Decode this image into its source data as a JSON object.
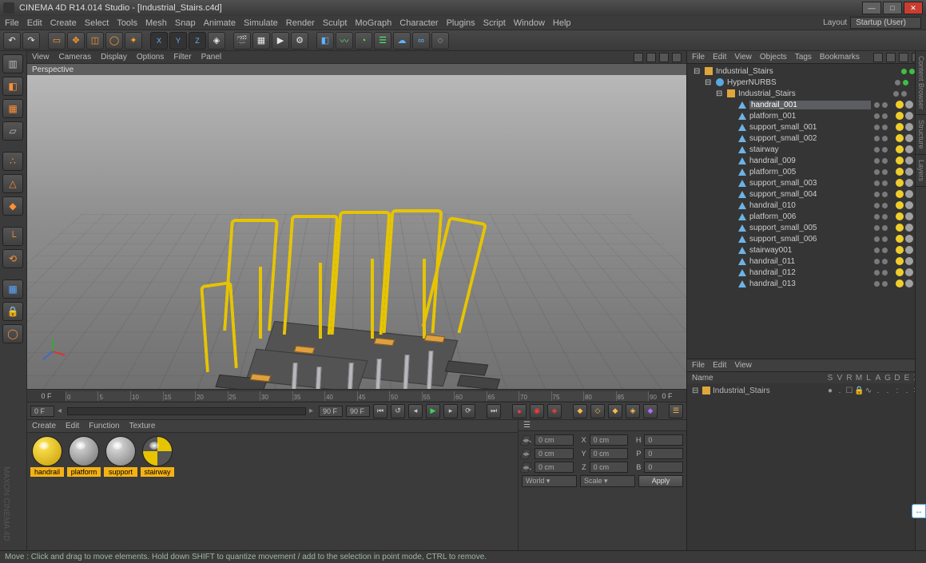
{
  "titlebar": {
    "text": "CINEMA 4D R14.014 Studio - [Industrial_Stairs.c4d]"
  },
  "menu": {
    "items": [
      "File",
      "Edit",
      "Create",
      "Select",
      "Tools",
      "Mesh",
      "Snap",
      "Animate",
      "Simulate",
      "Render",
      "Sculpt",
      "MoGraph",
      "Character",
      "Plugins",
      "Script",
      "Window",
      "Help"
    ],
    "layout_label": "Layout",
    "layout_value": "Startup (User)"
  },
  "viewport": {
    "menus": [
      "View",
      "Cameras",
      "Display",
      "Options",
      "Filter",
      "Panel"
    ],
    "label": "Perspective"
  },
  "timeline": {
    "start": "0 F",
    "end": "0 F",
    "ticks": [
      "0",
      "5",
      "10",
      "15",
      "20",
      "25",
      "30",
      "35",
      "40",
      "45",
      "50",
      "55",
      "60",
      "65",
      "70",
      "75",
      "80",
      "85",
      "90"
    ],
    "live_start": "0 F",
    "live_end": "90 F",
    "end2": "90 F"
  },
  "materials": {
    "menu": [
      "Create",
      "Edit",
      "Function",
      "Texture"
    ],
    "items": [
      {
        "name": "handrail",
        "bg": "radial-gradient(circle at 35% 30%, #ffe75a, #c79b00)"
      },
      {
        "name": "platform",
        "bg": "radial-gradient(circle at 35% 30%, #dcdcdc, #6e6e6e)"
      },
      {
        "name": "support",
        "bg": "radial-gradient(circle at 35% 30%, #e2e2e2, #7a7a7a)"
      },
      {
        "name": "stairway",
        "bg": "conic-gradient(#e6c400 0 90deg, #555 90deg 180deg, #e6c400 180deg 270deg, #555 270deg 360deg)"
      }
    ]
  },
  "coords": {
    "rows": [
      {
        "axis": "X",
        "p": "0 cm",
        "s": "0 cm",
        "a": "H",
        "v": "0"
      },
      {
        "axis": "Y",
        "p": "0 cm",
        "s": "0 cm",
        "a": "P",
        "v": "0"
      },
      {
        "axis": "Z",
        "p": "0 cm",
        "s": "0 cm",
        "a": "B",
        "v": "0"
      }
    ],
    "world": "World",
    "scale": "Scale",
    "apply": "Apply"
  },
  "objects": {
    "menu": [
      "File",
      "Edit",
      "View",
      "Objects",
      "Tags",
      "Bookmarks"
    ],
    "tree": [
      {
        "d": 0,
        "type": "cube",
        "name": "Industrial_Stairs",
        "exp": "⊟",
        "dots": [
          "green",
          "green"
        ],
        "tags": []
      },
      {
        "d": 1,
        "type": "null",
        "name": "HyperNURBS",
        "exp": "⊟",
        "dots": [
          "grey",
          "green"
        ],
        "tags": [
          "green-check"
        ]
      },
      {
        "d": 2,
        "type": "cube",
        "name": "Industrial_Stairs",
        "exp": "⊟",
        "dots": [
          "grey",
          "grey"
        ],
        "tags": [
          "checker"
        ]
      },
      {
        "d": 3,
        "type": "pyr",
        "name": "handrail_001",
        "sel": true,
        "dots": [
          "grey",
          "grey"
        ],
        "tags": [
          "yellow",
          "grey",
          "checker"
        ]
      },
      {
        "d": 3,
        "type": "pyr",
        "name": "platform_001",
        "dots": [
          "grey",
          "grey"
        ],
        "tags": [
          "yellow",
          "grey",
          "checker"
        ]
      },
      {
        "d": 3,
        "type": "pyr",
        "name": "support_small_001",
        "dots": [
          "grey",
          "grey"
        ],
        "tags": [
          "yellow",
          "grey",
          "checker"
        ]
      },
      {
        "d": 3,
        "type": "pyr",
        "name": "support_small_002",
        "dots": [
          "grey",
          "grey"
        ],
        "tags": [
          "yellow",
          "grey",
          "checker"
        ]
      },
      {
        "d": 3,
        "type": "pyr",
        "name": "stairway",
        "dots": [
          "grey",
          "grey"
        ],
        "tags": [
          "yellow",
          "grey",
          "checker"
        ]
      },
      {
        "d": 3,
        "type": "pyr",
        "name": "handrail_009",
        "dots": [
          "grey",
          "grey"
        ],
        "tags": [
          "yellow",
          "grey",
          "checker"
        ]
      },
      {
        "d": 3,
        "type": "pyr",
        "name": "platform_005",
        "dots": [
          "grey",
          "grey"
        ],
        "tags": [
          "yellow",
          "grey",
          "checker"
        ]
      },
      {
        "d": 3,
        "type": "pyr",
        "name": "support_small_003",
        "dots": [
          "grey",
          "grey"
        ],
        "tags": [
          "yellow",
          "grey",
          "checker"
        ]
      },
      {
        "d": 3,
        "type": "pyr",
        "name": "support_small_004",
        "dots": [
          "grey",
          "grey"
        ],
        "tags": [
          "yellow",
          "grey",
          "checker"
        ]
      },
      {
        "d": 3,
        "type": "pyr",
        "name": "handrail_010",
        "dots": [
          "grey",
          "grey"
        ],
        "tags": [
          "yellow",
          "grey",
          "checker"
        ]
      },
      {
        "d": 3,
        "type": "pyr",
        "name": "platform_006",
        "dots": [
          "grey",
          "grey"
        ],
        "tags": [
          "yellow",
          "grey",
          "checker"
        ]
      },
      {
        "d": 3,
        "type": "pyr",
        "name": "support_small_005",
        "dots": [
          "grey",
          "grey"
        ],
        "tags": [
          "yellow",
          "grey",
          "checker"
        ]
      },
      {
        "d": 3,
        "type": "pyr",
        "name": "support_small_006",
        "dots": [
          "grey",
          "grey"
        ],
        "tags": [
          "yellow",
          "grey",
          "checker"
        ]
      },
      {
        "d": 3,
        "type": "pyr",
        "name": "stairway001",
        "dots": [
          "grey",
          "grey"
        ],
        "tags": [
          "yellow",
          "grey",
          "checker"
        ]
      },
      {
        "d": 3,
        "type": "pyr",
        "name": "handrail_011",
        "dots": [
          "grey",
          "grey"
        ],
        "tags": [
          "yellow",
          "grey",
          "checker"
        ]
      },
      {
        "d": 3,
        "type": "pyr",
        "name": "handrail_012",
        "dots": [
          "grey",
          "grey"
        ],
        "tags": [
          "yellow",
          "grey",
          "checker"
        ]
      },
      {
        "d": 3,
        "type": "pyr",
        "name": "handrail_013",
        "dots": [
          "grey",
          "grey"
        ],
        "tags": [
          "yellow",
          "grey",
          "checker"
        ]
      }
    ]
  },
  "layers": {
    "menu": [
      "File",
      "Edit",
      "View"
    ],
    "header_name": "Name",
    "cols": [
      "S",
      "V",
      "R",
      "M",
      "L",
      "A",
      "G",
      "D",
      "E",
      "X"
    ],
    "row_name": "Industrial_Stairs",
    "row_vals": [
      "●",
      ".",
      "☐",
      "🔒",
      "∿",
      ".",
      ".",
      ":",
      ".",
      "✕"
    ]
  },
  "side_tabs": [
    "Content Browser",
    "Structure",
    "Layers"
  ],
  "status": "Move : Click and drag to move elements. Hold down SHIFT to quantize movement / add to the selection in point mode, CTRL to remove.",
  "brand": "MAXON  CINEMA 4D"
}
